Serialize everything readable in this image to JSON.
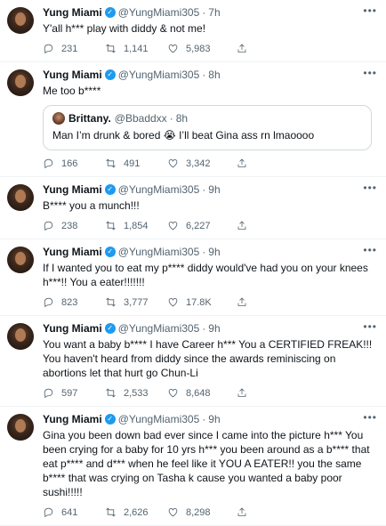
{
  "tweets": [
    {
      "name": "Yung Miami",
      "handle": "@YungMiami305",
      "time": "7h",
      "text": "Y'all h*** play with diddy & not me!",
      "replies": "231",
      "retweets": "1,141",
      "likes": "5,983"
    },
    {
      "name": "Yung Miami",
      "handle": "@YungMiami305",
      "time": "8h",
      "text": "Me too b****",
      "quote": {
        "name": "Brittany.",
        "handle": "@Bbaddxx",
        "time": "8h",
        "text": "Man I’m drunk & bored 😭 I’ll beat Gina ass rn lmaoooo"
      },
      "replies": "166",
      "retweets": "491",
      "likes": "3,342"
    },
    {
      "name": "Yung Miami",
      "handle": "@YungMiami305",
      "time": "9h",
      "text": "B**** you a munch!!!",
      "replies": "238",
      "retweets": "1,854",
      "likes": "6,227"
    },
    {
      "name": "Yung Miami",
      "handle": "@YungMiami305",
      "time": "9h",
      "text": "If I wanted you to eat my p**** diddy would've had you on your knees h***!! You a eater!!!!!!!",
      "replies": "823",
      "retweets": "3,777",
      "likes": "17.8K"
    },
    {
      "name": "Yung Miami",
      "handle": "@YungMiami305",
      "time": "9h",
      "text": "You want a baby b**** I have Career h*** You a CERTIFIED FREAK!!! You haven't heard from diddy since the awards reminiscing on abortions let that hurt go Chun-Li",
      "replies": "597",
      "retweets": "2,533",
      "likes": "8,648"
    },
    {
      "name": "Yung Miami",
      "handle": "@YungMiami305",
      "time": "9h",
      "text": "Gina you been down bad ever since I came into the picture h*** You been crying for a baby for 10 yrs h*** you been around as a b**** that eat p**** and d*** when he feel like it YOU A EATER!! you the same b**** that was crying on Tasha k cause you wanted a baby poor sushi!!!!!",
      "replies": "641",
      "retweets": "2,626",
      "likes": "8,298"
    }
  ],
  "icons": {
    "verified": "verified-badge-icon",
    "more": "more-options-icon",
    "reply": "reply-icon",
    "retweet": "retweet-icon",
    "like": "like-icon",
    "share": "share-icon"
  },
  "colors": {
    "verified": "#1d9bf0",
    "secondary_text": "#536471",
    "divider": "#eff3f4"
  }
}
